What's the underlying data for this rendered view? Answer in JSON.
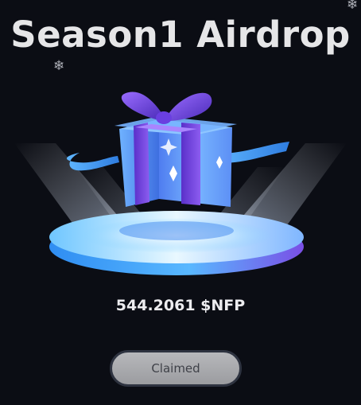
{
  "title": "Season1 Airdrop",
  "reward": {
    "amount": "544.2061 $NFP"
  },
  "claim_button": {
    "label": "Claimed",
    "state": "disabled"
  },
  "decorations": {
    "snowflake_glyph": "❄",
    "gift_icon": "gift-box-on-pedestal"
  },
  "colors": {
    "background": "#0b0d14",
    "gift_purple": "#7c4ae0",
    "gift_blue": "#5aa8ff",
    "pedestal_cyan": "#7fd0ff",
    "button_disabled": "#a9aaae"
  }
}
